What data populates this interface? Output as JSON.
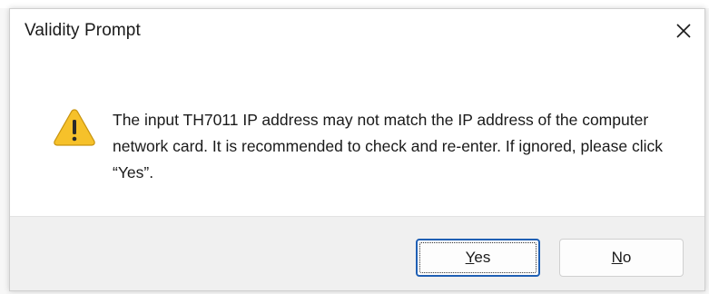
{
  "dialog": {
    "title": "Validity Prompt",
    "close_icon": "close-icon",
    "warning_icon": "warning-icon",
    "message": "The input TH7011 IP address may not match the IP address of the computer network card. It is recommended to check and re-enter. If ignored, please click “Yes”.",
    "buttons": {
      "yes": {
        "mnemonic": "Y",
        "rest": "es",
        "default": true
      },
      "no": {
        "mnemonic": "N",
        "rest": "o"
      }
    }
  },
  "colors": {
    "warning_fill": "#f6c12a",
    "warning_outline": "#c8940f",
    "default_button_border": "#1f5fb4",
    "footer_background": "#f0f0f0"
  }
}
